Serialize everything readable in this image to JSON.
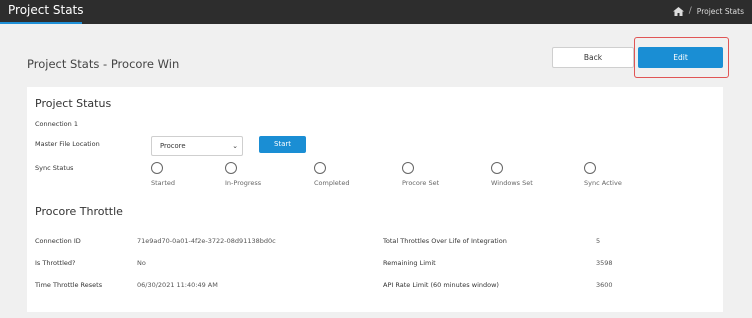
{
  "header": {
    "title": "Project Stats",
    "breadcrumb_current": "Project Stats",
    "breadcrumb_separator": "/"
  },
  "page": {
    "title": "Project Stats - Procore Win",
    "back_label": "Back",
    "edit_label": "Edit"
  },
  "project_status": {
    "title": "Project Status",
    "connection_label": "Connection 1",
    "master_file_location_label": "Master File Location",
    "master_file_location_value": "Procore",
    "start_label": "Start",
    "sync_status_label": "Sync Status",
    "sync_statuses": [
      "Started",
      "In-Progress",
      "Completed",
      "Procore Set",
      "Windows Set",
      "Sync Active"
    ]
  },
  "throttle": {
    "title": "Procore Throttle",
    "connection_id_label": "Connection ID",
    "connection_id_value": "71e9ad70-0a01-4f2e-3722-08d91138bd0c",
    "is_throttled_label": "Is Throttled?",
    "is_throttled_value": "No",
    "resets_label": "Time Throttle Resets",
    "resets_value": "06/30/2021 11:40:49 AM",
    "total_label": "Total Throttles Over Life of Integration",
    "total_value": "5",
    "remaining_label": "Remaining Limit",
    "remaining_value": "3598",
    "rate_label": "API Rate Limit (60 minutes window)",
    "rate_value": "3600"
  },
  "colors": {
    "topbar": "#2d2d2d",
    "accent": "#1a8ed4",
    "highlight": "#e05555"
  },
  "icons": [
    "home-icon",
    "chevron-down-icon"
  ]
}
